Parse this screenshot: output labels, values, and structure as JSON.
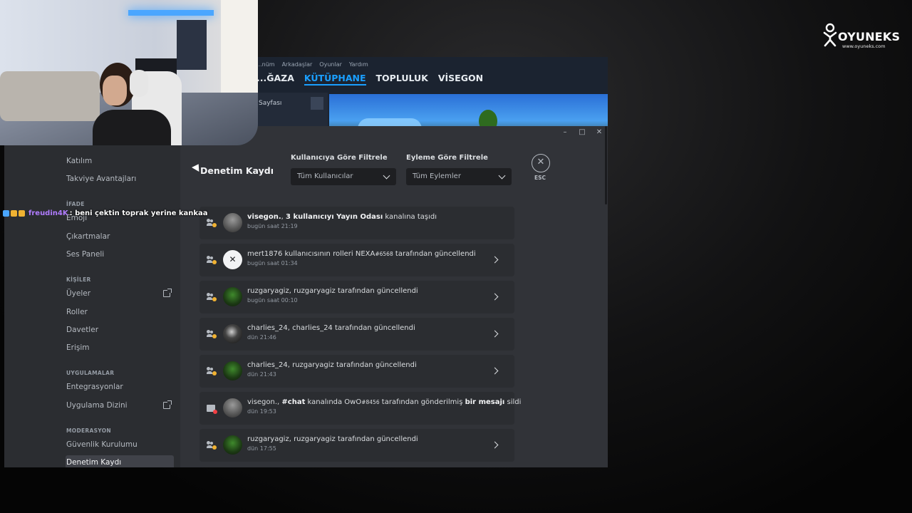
{
  "steam": {
    "menu": [
      "...nüm",
      "Arkadaşlar",
      "Oyunlar",
      "Yardım"
    ],
    "tabs": [
      {
        "label": "...ĞAZA"
      },
      {
        "label": "KÜTÜPHANE"
      },
      {
        "label": "TOPLULUK"
      },
      {
        "label": "VİSEGON"
      }
    ],
    "left_row": "Sayfası"
  },
  "window_controls": {
    "minimize": "–",
    "maximize": "□",
    "close": "✕"
  },
  "sidebar": {
    "items": [
      {
        "type": "item",
        "label": "Katılım"
      },
      {
        "type": "item",
        "label": "Takviye Avantajları"
      },
      {
        "type": "header",
        "label": "İFADE"
      },
      {
        "type": "item",
        "label": "Emoji"
      },
      {
        "type": "item",
        "label": "Çıkartmalar"
      },
      {
        "type": "item",
        "label": "Ses Paneli"
      },
      {
        "type": "header",
        "label": "KİŞİLER"
      },
      {
        "type": "item",
        "label": "Üyeler"
      },
      {
        "type": "item",
        "label": "Roller"
      },
      {
        "type": "item",
        "label": "Davetler"
      },
      {
        "type": "item",
        "label": "Erişim"
      },
      {
        "type": "header",
        "label": "UYGULAMALAR"
      },
      {
        "type": "item",
        "label": "Entegrasyonlar"
      },
      {
        "type": "item",
        "label": "Uygulama Dizini"
      },
      {
        "type": "header",
        "label": "MODERASYON"
      },
      {
        "type": "item",
        "label": "Güvenlik Kurulumu"
      },
      {
        "type": "item",
        "label": "Denetim Kaydı"
      }
    ]
  },
  "audit": {
    "title": "Denetim Kaydı",
    "filter_user_label": "Kullanıcıya Göre Filtrele",
    "filter_user_value": "Tüm Kullanıcılar",
    "filter_action_label": "Eyleme Göre Filtrele",
    "filter_action_value": "Tüm Eylemler",
    "close_icon": "✕",
    "esc_label": "ESC",
    "entries": [
      {
        "icon": "members-update-icon",
        "avatar": "gray",
        "parts": [
          [
            "b",
            "visegon."
          ],
          [
            "t",
            ", "
          ],
          [
            "b",
            "3 kullanıcıyı Yayın Odası"
          ],
          [
            "t",
            " kanalına taşıdı"
          ]
        ],
        "time": "bugün saat 21:19",
        "expandable": false
      },
      {
        "icon": "members-update-icon",
        "avatar": "nexa",
        "parts": [
          [
            "t",
            "mert1876 kullanıcısının rolleri NEXA"
          ],
          [
            "s",
            "#6568"
          ],
          [
            "t",
            " tarafından güncellendi"
          ]
        ],
        "time": "bugün saat 01:34",
        "expandable": true
      },
      {
        "icon": "members-update-icon",
        "avatar": "green",
        "parts": [
          [
            "t",
            "ruzgaryagiz, ruzgaryagiz tarafından güncellendi"
          ]
        ],
        "time": "bugün saat 00:10",
        "expandable": true
      },
      {
        "icon": "members-update-icon",
        "avatar": "dark",
        "parts": [
          [
            "t",
            "charlies_24, charlies_24 tarafından güncellendi"
          ]
        ],
        "time": "dün 21:46",
        "expandable": true
      },
      {
        "icon": "members-update-icon",
        "avatar": "green",
        "parts": [
          [
            "t",
            "charlies_24, ruzgaryagiz tarafından güncellendi"
          ]
        ],
        "time": "dün 21:43",
        "expandable": true
      },
      {
        "icon": "message-delete-icon",
        "avatar": "gray",
        "parts": [
          [
            "t",
            "visegon., "
          ],
          [
            "b",
            "#chat"
          ],
          [
            "t",
            " kanalında OwO"
          ],
          [
            "s",
            "#8456"
          ],
          [
            "t",
            " tarafından gönderilmiş "
          ],
          [
            "b",
            "bir mesajı"
          ],
          [
            "t",
            " sildi"
          ]
        ],
        "time": "dün 19:53",
        "expandable": false
      },
      {
        "icon": "members-update-icon",
        "avatar": "green",
        "parts": [
          [
            "t",
            "ruzgaryagiz, ruzgaryagiz tarafından güncellendi"
          ]
        ],
        "time": "dün 17:55",
        "expandable": true
      }
    ]
  },
  "chat_overlay": {
    "username": "freudin4K",
    "message": ": beni çektin toprak yerine kankaa",
    "badge_colors": [
      "#4aa6ff",
      "#f0b232",
      "#f0b232"
    ]
  },
  "logo": {
    "name": "OYUNEKS",
    "url": "www.oyuneks.com"
  },
  "colors": {
    "accent": "#1a9fff",
    "discord_bg": "#313338",
    "sidebar_bg": "#2b2d31",
    "chat_user": "#b07cff"
  }
}
